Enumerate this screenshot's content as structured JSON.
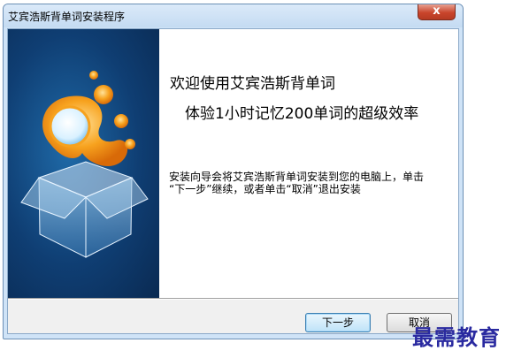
{
  "window": {
    "title": "艾宾浩斯背单词安装程序",
    "close_label": "x"
  },
  "content": {
    "welcome": "欢迎使用艾宾浩斯背单词",
    "slogan": "体验1小时记忆200单词的超级效率",
    "description_line1": "安装向导会将艾宾浩斯背单词安装到您的电脑上，单击",
    "description_line2": "“下一步”继续，或者单击“取消”退出安装"
  },
  "buttons": {
    "next": "下一步",
    "cancel": "取消"
  },
  "watermark": "最需教育",
  "colors": {
    "panel_blue": "#0f3e73",
    "accent_orange": "#f39a1e",
    "close_red": "#c9452c"
  }
}
